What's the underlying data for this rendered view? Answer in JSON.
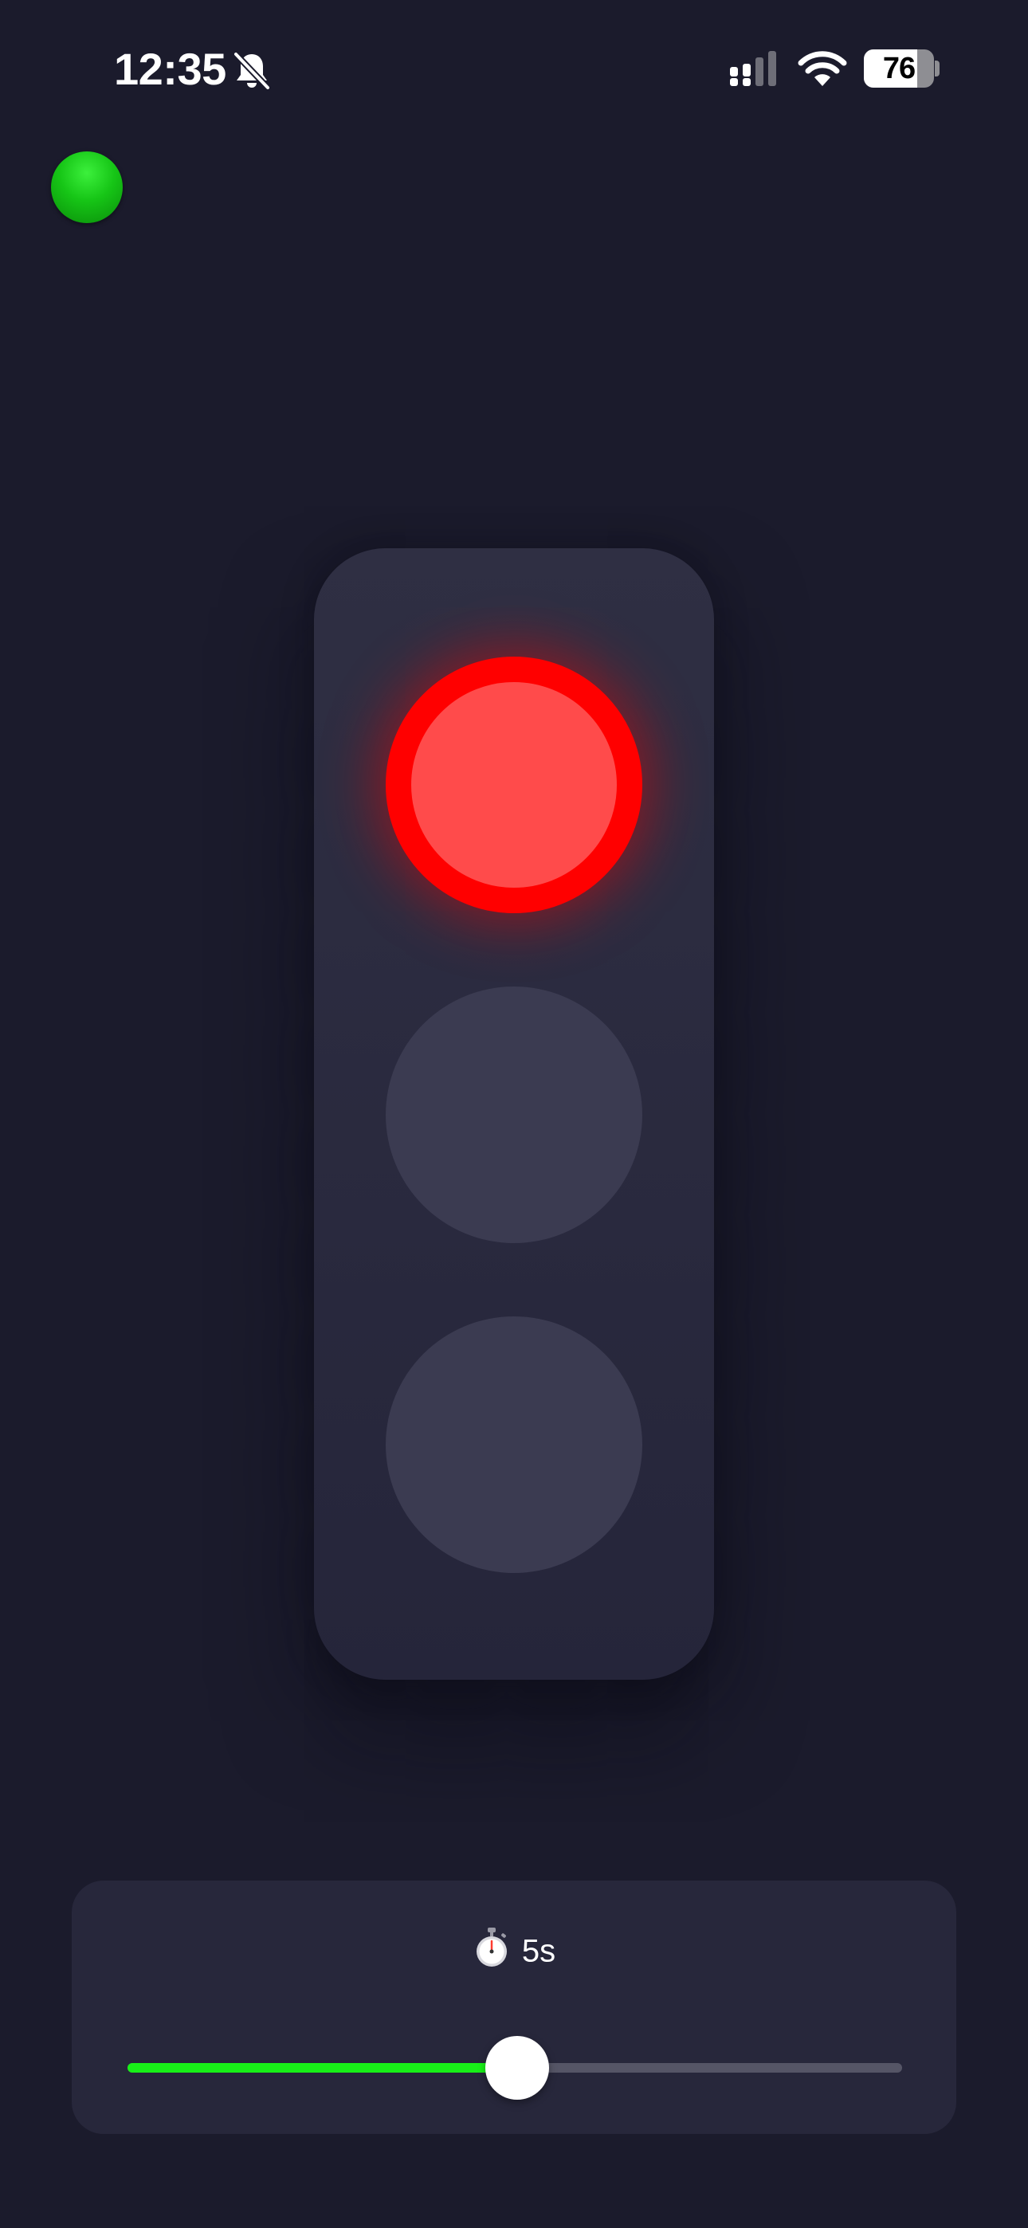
{
  "status_bar": {
    "time": "12:35",
    "battery_percent": "76",
    "battery_level": 0.76,
    "silent_icon": "bell-slash-icon",
    "signal_icon": "cellular-signal-icon",
    "wifi_icon": "wifi-icon"
  },
  "connection_indicator": {
    "icon": "green-dot-icon",
    "color": "#16c516"
  },
  "traffic_light": {
    "active_lamp": "red",
    "colors": {
      "red_on": "#ff4b4b",
      "red_ring": "#ff0000",
      "off": "#3b3b51",
      "housing": "#2a2a3e"
    },
    "lamps": [
      {
        "name": "red",
        "state": "on"
      },
      {
        "name": "yellow",
        "state": "off"
      },
      {
        "name": "green",
        "state": "off"
      }
    ]
  },
  "timer": {
    "icon": "stopwatch-icon",
    "value_label": "5s",
    "slider_fraction": 0.503,
    "accent_color": "#18f018"
  },
  "background_color": "#1b1b2c"
}
